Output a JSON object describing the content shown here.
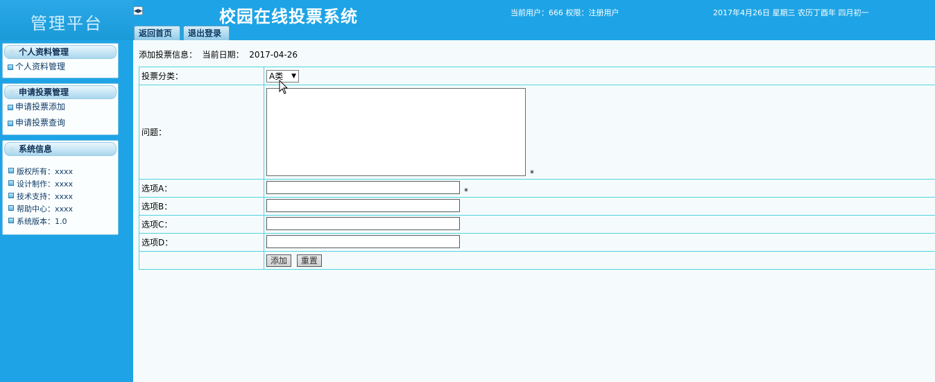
{
  "header": {
    "platform_title": "管理平台",
    "system_title": "校园在线投票系统",
    "user_info": "当前用户：666 权限：注册用户",
    "date_info": "2017年4月26日 星期三 农历丁酉年 四月初一",
    "tabs": [
      {
        "label": "返回首页"
      },
      {
        "label": "退出登录"
      }
    ]
  },
  "sidebar": {
    "panels": [
      {
        "title": "个人资料管理",
        "items": [
          {
            "label": "个人资料管理"
          }
        ]
      },
      {
        "title": "申请投票管理",
        "items": [
          {
            "label": "申请投票添加"
          },
          {
            "label": "申请投票查询"
          }
        ]
      },
      {
        "title": "系统信息",
        "items": [
          {
            "label": "版权所有：xxxx"
          },
          {
            "label": "设计制作：xxxx"
          },
          {
            "label": "技术支持：xxxx"
          },
          {
            "label": "帮助中心：xxxx"
          },
          {
            "label": "系统版本：1.0"
          }
        ]
      }
    ]
  },
  "main": {
    "heading": "添加投票信息：  当前日期：  2017-04-26",
    "form": {
      "category_label": "投票分类：",
      "category_value": "A类",
      "question_label": "问题：",
      "required_mark": "*",
      "option_a_label": "选项A：",
      "option_b_label": "选项B：",
      "option_c_label": "选项C：",
      "option_d_label": "选项D：",
      "add_button": "添加",
      "reset_button": "重置"
    }
  },
  "colors": {
    "header_bg": "#1ea4e6",
    "content_bg": "#f5fbfc",
    "table_border": "#4fd3e0"
  }
}
